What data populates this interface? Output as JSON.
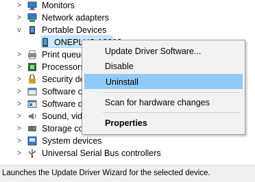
{
  "tree": {
    "items": [
      {
        "label": "Monitors",
        "chevron": ">",
        "icon": "monitor-icon"
      },
      {
        "label": "Network adapters",
        "chevron": ">",
        "icon": "network-adapter-icon"
      },
      {
        "label": "Portable Devices",
        "chevron": "v",
        "icon": "portable-devices-icon"
      },
      {
        "label": "ONEPLUS A3003",
        "chevron": "",
        "icon": "phone-icon",
        "selected": true
      },
      {
        "label": "Print queue",
        "chevron": ">",
        "icon": "printer-icon"
      },
      {
        "label": "Processors",
        "chevron": ">",
        "icon": "processor-icon"
      },
      {
        "label": "Security de",
        "chevron": ">",
        "icon": "security-device-icon"
      },
      {
        "label": "Software co",
        "chevron": ">",
        "icon": "software-component-icon"
      },
      {
        "label": "Software de",
        "chevron": ">",
        "icon": "software-device-icon"
      },
      {
        "label": "Sound, vide",
        "chevron": ">",
        "icon": "speaker-icon"
      },
      {
        "label": "Storage con",
        "chevron": ">",
        "icon": "storage-controller-icon"
      },
      {
        "label": "System devices",
        "chevron": ">",
        "icon": "system-devices-icon"
      },
      {
        "label": "Universal Serial Bus controllers",
        "chevron": ">",
        "icon": "usb-icon"
      }
    ]
  },
  "context_menu": {
    "items": [
      {
        "label": "Update Driver Software..."
      },
      {
        "label": "Disable"
      },
      {
        "label": "Uninstall",
        "highlighted": true
      },
      {
        "label": "Scan for hardware changes"
      },
      {
        "label": "Properties",
        "bold": true
      }
    ]
  },
  "status_bar": {
    "text": "Launches the Update Driver Wizard for the selected device."
  },
  "colors": {
    "selection_bg": "#cce8ff",
    "menu_highlight": "#91c9f7",
    "menu_bg": "#f2f2f2",
    "status_bg": "#f0f0f0"
  }
}
